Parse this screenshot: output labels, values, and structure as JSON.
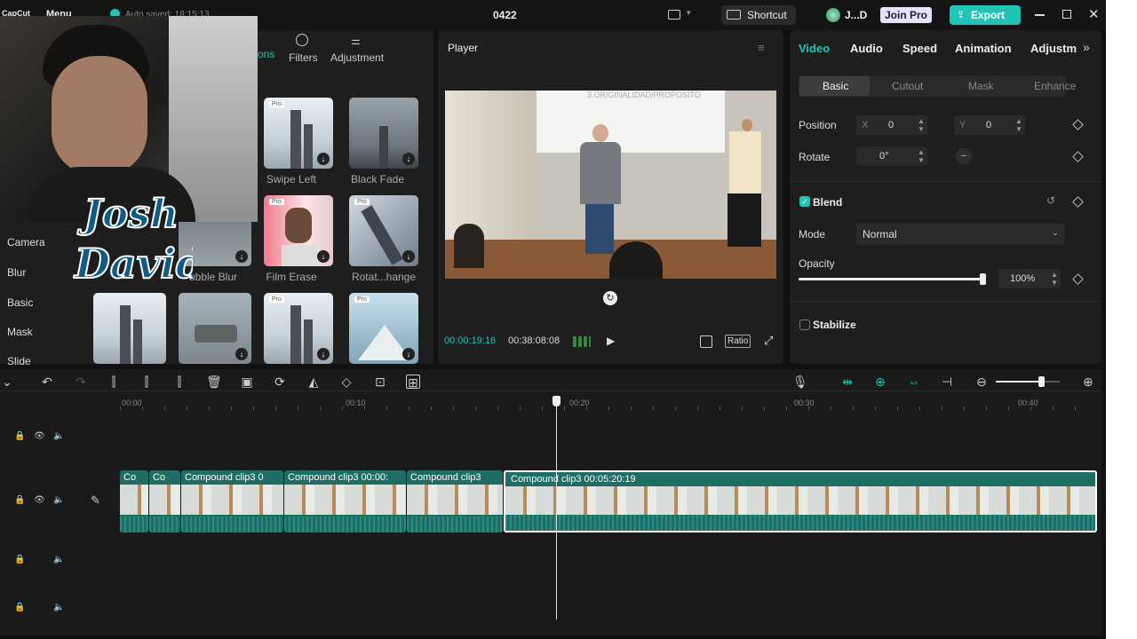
{
  "topbar": {
    "app_name": "CapCut",
    "menu_label": "Menu",
    "autosave": "Auto saved: 18:15:13",
    "project_title": "0422",
    "shortcut_label": "Shortcut",
    "user_label": "J...D",
    "join_pro_label": "Join Pro",
    "export_label": "Export"
  },
  "overlay": {
    "logo_text": "Josh David"
  },
  "media_panel": {
    "tabs": [
      {
        "label": "ons"
      },
      {
        "label": "Filters"
      },
      {
        "label": "Adjustment"
      }
    ],
    "sidebar": [
      "Camera",
      "Blur",
      "Basic",
      "Mask",
      "Slide"
    ],
    "items": [
      {
        "label": "Swipe Left",
        "pro": "Pro"
      },
      {
        "label": "Black Fade"
      },
      {
        "label": "ubble Blur"
      },
      {
        "label": "Film Erase",
        "pro": "Pro"
      },
      {
        "label": "Rotat...hange",
        "pro": "Pro"
      },
      {
        "label": ""
      },
      {
        "label": ""
      },
      {
        "label": "",
        "pro": "Pro"
      },
      {
        "label": "",
        "pro": "Pro"
      }
    ]
  },
  "player": {
    "title": "Player",
    "banner": "3.ORIGINALIDAD/PROPOSITO",
    "current_time": "00:00:19:16",
    "total_time": "00:38:08:08",
    "ratio_label": "Ratio"
  },
  "props": {
    "tabs": [
      "Video",
      "Audio",
      "Speed",
      "Animation",
      "Adjustm"
    ],
    "subtabs": [
      "Basic",
      "Cutout",
      "Mask",
      "Enhance"
    ],
    "position_label": "Position",
    "x_label": "X",
    "x_value": "0",
    "y_label": "Y",
    "y_value": "0",
    "rotate_label": "Rotate",
    "rotate_value": "0°",
    "blend_label": "Blend",
    "mode_label": "Mode",
    "mode_value": "Normal",
    "opacity_label": "Opacity",
    "opacity_value": "100%",
    "opacity_level": 1.0,
    "stabilize_label": "Stabilize"
  },
  "timeline": {
    "ruler": [
      "00:00",
      "00:10",
      "00:20",
      "00:30",
      "00:40"
    ],
    "clips": [
      {
        "label": "Co"
      },
      {
        "label": "Co"
      },
      {
        "label": "Compound clip3  0"
      },
      {
        "label": "Compound clip3  00:00:"
      },
      {
        "label": "Compound clip3"
      },
      {
        "label": "Compound clip3   00:05:20:19"
      }
    ],
    "zoom_level": 0.72
  }
}
